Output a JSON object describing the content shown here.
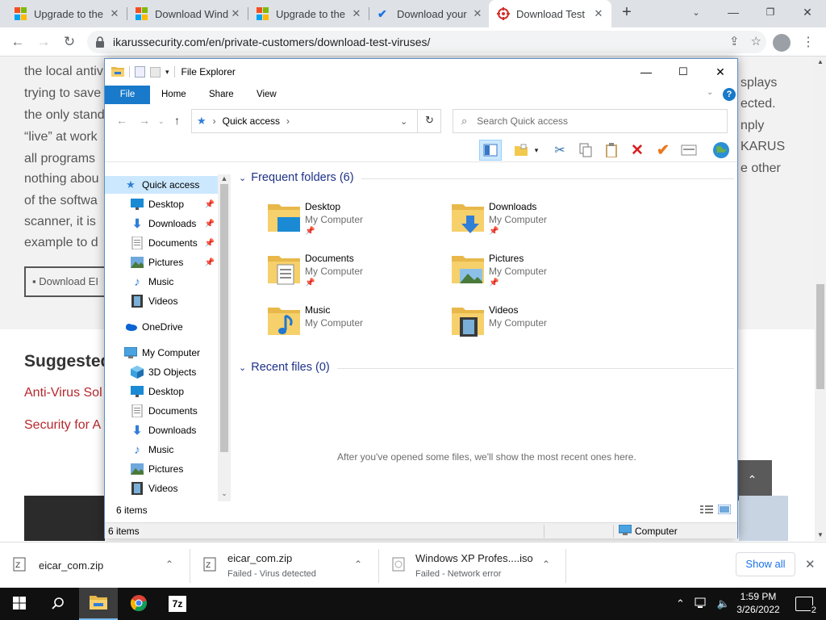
{
  "browser": {
    "tabs": [
      {
        "title": "Upgrade to the",
        "icon": "windows-logo-icon",
        "active": false
      },
      {
        "title": "Download Wind",
        "icon": "windows-logo-icon",
        "active": false
      },
      {
        "title": "Upgrade to the",
        "icon": "windows-logo-icon",
        "active": false
      },
      {
        "title": "Download your",
        "icon": "checkmark-logo-icon",
        "active": false
      },
      {
        "title": "Download Test",
        "icon": "ikarus-logo-icon",
        "active": true
      }
    ],
    "url": "ikarussecurity.com/en/private-customers/download-test-viruses/"
  },
  "webpage": {
    "body_lines": [
      "the local antiv",
      "trying to save",
      "the only stand",
      "“live” at work",
      "all programs",
      "nothing abou",
      "of the softwa",
      "scanner, it is",
      "example to d"
    ],
    "right_lines": [
      "splays",
      "ected.",
      "nply",
      "KARUS",
      "e other"
    ],
    "download_button": "Download EI",
    "suggested_heading": "Suggested",
    "links": [
      "Anti-Virus Sol",
      "Security for A"
    ]
  },
  "explorer": {
    "title": "File Explorer",
    "menu": [
      "File",
      "Home",
      "Share",
      "View"
    ],
    "help": "?",
    "address": "Quick access",
    "search_placeholder": "Search Quick access",
    "nav": {
      "quick_access": "Quick access",
      "quick_items": [
        {
          "label": "Desktop",
          "icon": "desktop-icon",
          "pinned": true
        },
        {
          "label": "Downloads",
          "icon": "download-arrow-icon",
          "pinned": true
        },
        {
          "label": "Documents",
          "icon": "documents-icon",
          "pinned": true
        },
        {
          "label": "Pictures",
          "icon": "pictures-icon",
          "pinned": true
        },
        {
          "label": "Music",
          "icon": "music-note-icon",
          "pinned": false
        },
        {
          "label": "Videos",
          "icon": "videos-icon",
          "pinned": false
        }
      ],
      "onedrive": "OneDrive",
      "computer": "My Computer",
      "computer_items": [
        {
          "label": "3D Objects",
          "icon": "3d-objects-icon"
        },
        {
          "label": "Desktop",
          "icon": "desktop-icon"
        },
        {
          "label": "Documents",
          "icon": "documents-icon"
        },
        {
          "label": "Downloads",
          "icon": "download-arrow-icon"
        },
        {
          "label": "Music",
          "icon": "music-note-icon"
        },
        {
          "label": "Pictures",
          "icon": "pictures-icon"
        },
        {
          "label": "Videos",
          "icon": "videos-icon"
        }
      ]
    },
    "frequent_header": "Frequent folders (6)",
    "folders": [
      {
        "name": "Desktop",
        "location": "My Computer",
        "icon": "desktop-folder-icon"
      },
      {
        "name": "Downloads",
        "location": "My Computer",
        "icon": "downloads-folder-icon"
      },
      {
        "name": "Documents",
        "location": "My Computer",
        "icon": "documents-folder-icon"
      },
      {
        "name": "Pictures",
        "location": "My Computer",
        "icon": "pictures-folder-icon"
      },
      {
        "name": "Music",
        "location": "My Computer",
        "icon": "music-folder-icon"
      },
      {
        "name": "Videos",
        "location": "My Computer",
        "icon": "videos-folder-icon"
      }
    ],
    "recent_header": "Recent files (0)",
    "recent_empty": "After you've opened some files, we'll show the most recent ones here.",
    "status_items": "6 items",
    "statusbar_items": "6 items",
    "statusbar_location": "Computer"
  },
  "downloads": [
    {
      "name": "eicar_com.zip",
      "status": ""
    },
    {
      "name": "eicar_com.zip",
      "status": "Failed - Virus detected"
    },
    {
      "name": "Windows XP Profes....iso",
      "status": "Failed - Network error"
    }
  ],
  "show_all": "Show all",
  "taskbar": {
    "time": "1:59 PM",
    "date": "3/26/2022",
    "notifications": "2",
    "apps": [
      "file-explorer-icon",
      "chrome-icon",
      "7zip-icon"
    ]
  },
  "colors": {
    "accent": "#1979ca",
    "link_red": "#b5282e",
    "group_header": "#1e3287"
  }
}
